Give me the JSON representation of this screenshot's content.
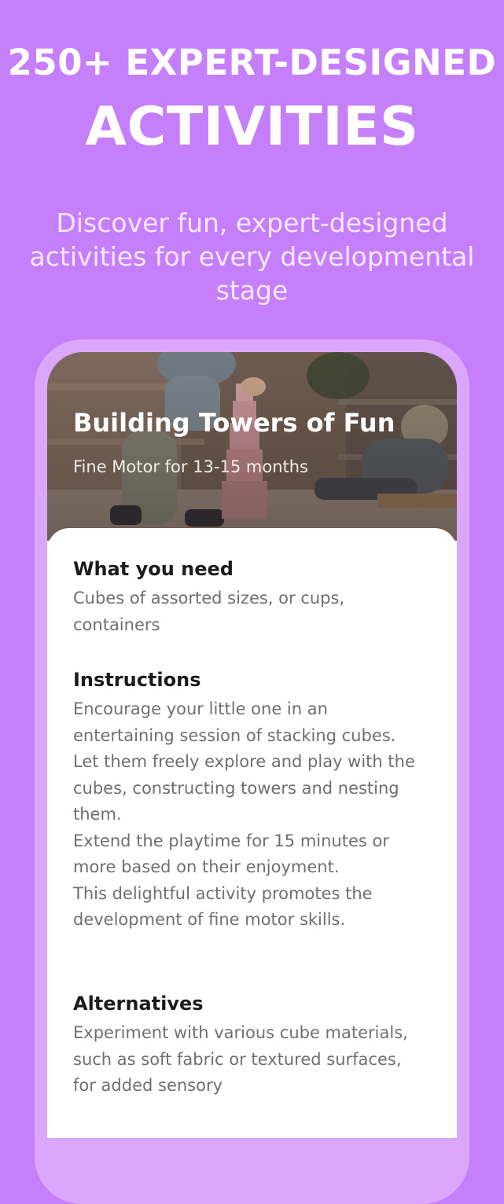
{
  "header": {
    "line1": "250+ EXPERT-DESIGNED",
    "line2": "ACTIVITIES",
    "subtitle": "Discover fun, expert-designed activities for every developmental stage"
  },
  "activity": {
    "title": "Building Towers of Fun",
    "subtitle": "Fine Motor for 13-15 months",
    "sections": {
      "needs": {
        "heading": "What you need",
        "body": "Cubes of assorted sizes, or cups, containers"
      },
      "instructions": {
        "heading": "Instructions",
        "body": "Encourage your little one in an entertaining session of stacking cubes.\nLet them freely explore and play with the cubes, constructing towers and nesting them.\nExtend the playtime for 15 minutes or more based on their enjoyment.\nThis delightful activity promotes the development of fine motor skills."
      },
      "alternatives": {
        "heading": "Alternatives",
        "body": "Experiment with various cube materials, such as soft fabric or textured surfaces, for added sensory"
      }
    }
  },
  "colors": {
    "background": "#c67ffb",
    "phone_frame": "#dba6fb",
    "heading_text": "#1c1c1c",
    "body_text": "#6f6f6f"
  }
}
